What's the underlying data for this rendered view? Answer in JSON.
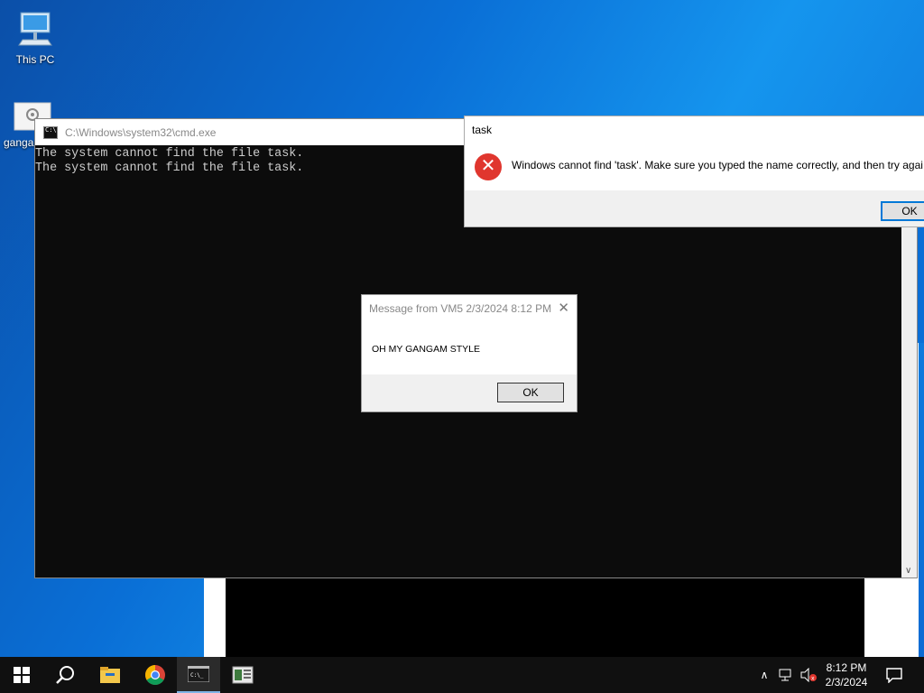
{
  "desktop": {
    "icons": [
      {
        "label": "This PC",
        "icon": "computer-icon"
      },
      {
        "label": "gangam",
        "icon": "settings-file-icon"
      }
    ]
  },
  "cmd_window": {
    "title": "C:\\Windows\\system32\\cmd.exe",
    "lines": [
      "The system cannot find the file task.",
      "The system cannot find the file task."
    ]
  },
  "error_dialog": {
    "title": "task",
    "message": "Windows cannot find 'task'. Make sure you typed the name correctly, and then try agai",
    "ok_label": "OK",
    "icon": "error-icon"
  },
  "message_dialog": {
    "title": "Message from VM5 2/3/2024 8:12 PM",
    "text": "OH MY GANGAM STYLE",
    "ok_label": "OK"
  },
  "taskbar": {
    "apps": [
      "start-icon",
      "search-icon",
      "file-explorer-icon",
      "chrome-icon",
      "cmd-icon",
      "app-icon"
    ],
    "time": "8:12 PM",
    "date": "2/3/2024"
  },
  "colors": {
    "accent": "#0078d7",
    "error": "#e0362e",
    "taskbar": "#101010"
  }
}
